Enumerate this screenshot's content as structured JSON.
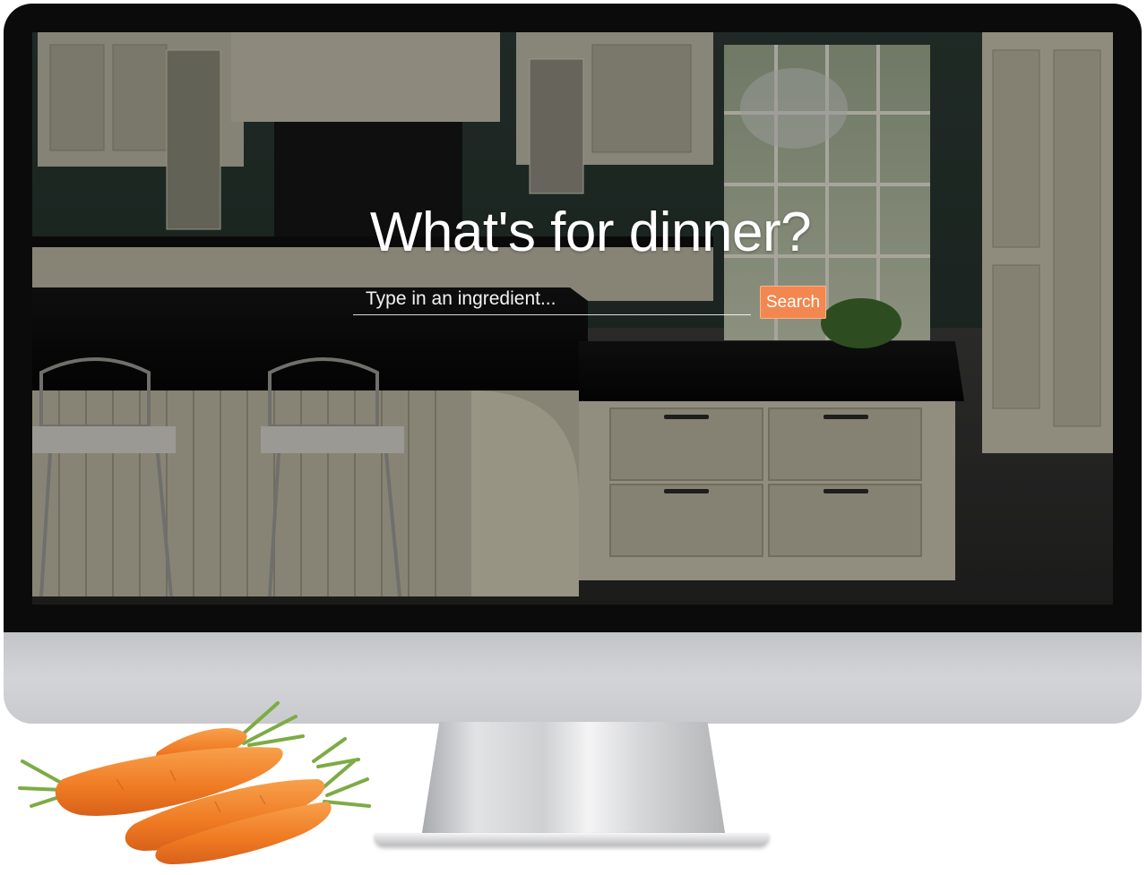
{
  "hero": {
    "title": "What's for dinner?"
  },
  "search": {
    "placeholder": "Type in an ingredient...",
    "value": "",
    "button_label": "Search"
  },
  "colors": {
    "accent": "#f2874f",
    "bezel": "#0b0b0c",
    "chin": "#cbcccf"
  },
  "icons": {
    "background_photo": "kitchen-photo",
    "decoration": "carrots-image"
  }
}
